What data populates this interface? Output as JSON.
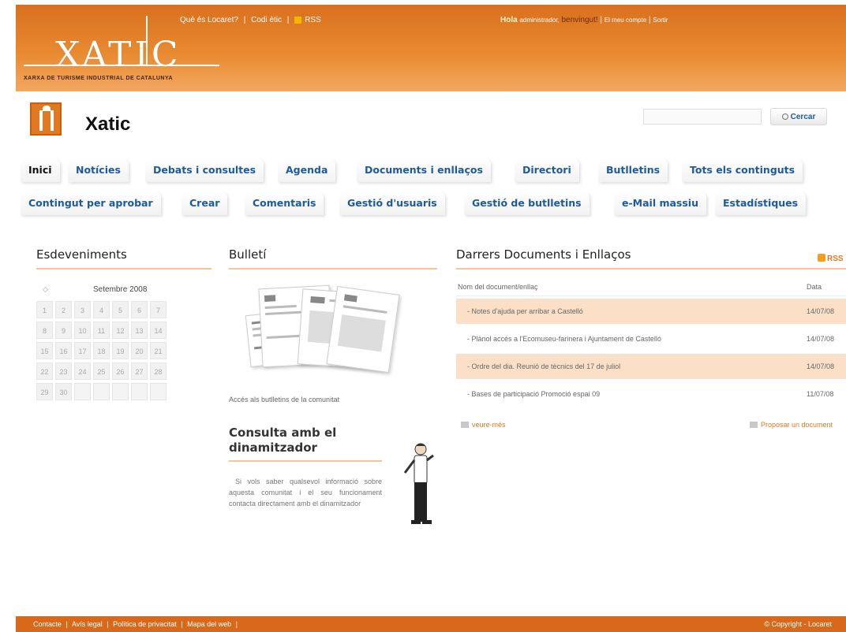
{
  "header": {
    "logo_word": "XATIC",
    "logo_tagline": "Xarxa de Turisme Industrial de Catalunya",
    "top_links": [
      "Què és Locaret?",
      "|",
      "Codi ètic",
      "|",
      "RSS"
    ],
    "user": {
      "hello": "Hola",
      "username": "administrador,",
      "welcome": "benvingut!",
      "sep": "|",
      "my_account": "El meu compte",
      "sep2": "|",
      "logout": "Sortir"
    }
  },
  "site": {
    "title": "Xatic",
    "search_placeholder": "",
    "search_button": "Cercar"
  },
  "tabs_row_1": [
    "Inici",
    "Notícies",
    "Debats i consultes",
    "Agenda",
    "Documents i enllaços",
    "Directori",
    "Butlletins",
    "Tots els continguts"
  ],
  "tabs_row_2": [
    "Contingut per aprobar",
    "Crear",
    "Comentaris",
    "Gestió d'usuaris",
    "Gestió de butlletins",
    "e-Mail massiu",
    "Estadístiques"
  ],
  "events": {
    "heading": "Esdeveniments",
    "prev": "◇",
    "month": "Setembre 2008",
    "weeks": [
      [
        "1",
        "2",
        "3",
        "4",
        "5",
        "6",
        "7"
      ],
      [
        "8",
        "9",
        "10",
        "11",
        "12",
        "13",
        "14"
      ],
      [
        "15",
        "16",
        "17",
        "18",
        "19",
        "20",
        "21"
      ],
      [
        "22",
        "23",
        "24",
        "25",
        "26",
        "27",
        "28"
      ],
      [
        "29",
        "30",
        "",
        "",
        "",
        "",
        ""
      ]
    ]
  },
  "bulleti": {
    "heading": "Bulletí",
    "caption": "Accés als butlletins de la comunitat"
  },
  "consulta": {
    "heading": "Consulta amb el dinamitzador",
    "text": "Si vols saber qualsevol informació sobre aquesta comunitat i el seu funcionament contacta directament amb el dinamitzador"
  },
  "docs": {
    "heading": "Darrers Documents i Enllaços",
    "rss": "RSS",
    "col_name": "Nom del document/enllaç",
    "col_date": "Data",
    "rows": [
      {
        "name": "- Notes d'ajuda per arribar a Castelló",
        "date": "14/07/08"
      },
      {
        "name": "- Plànol accés a l'Ecomuseu-farinera i Ajuntament de Castelló",
        "date": "14/07/08"
      },
      {
        "name": "- Ordre del dia. Reunió de tècnics del 17 de juliol",
        "date": "14/07/08"
      },
      {
        "name": "- Bases de participació Promoció espai 09",
        "date": "11/07/08"
      }
    ],
    "see_more": "veure-més",
    "propose": "Proposar un document"
  },
  "footer": {
    "links": [
      "Contacte",
      "|",
      "Avís legal",
      "|",
      "Política de privacitat",
      "|",
      "Mapa del web",
      "|"
    ],
    "copyright": "© Copyright - Locaret"
  }
}
